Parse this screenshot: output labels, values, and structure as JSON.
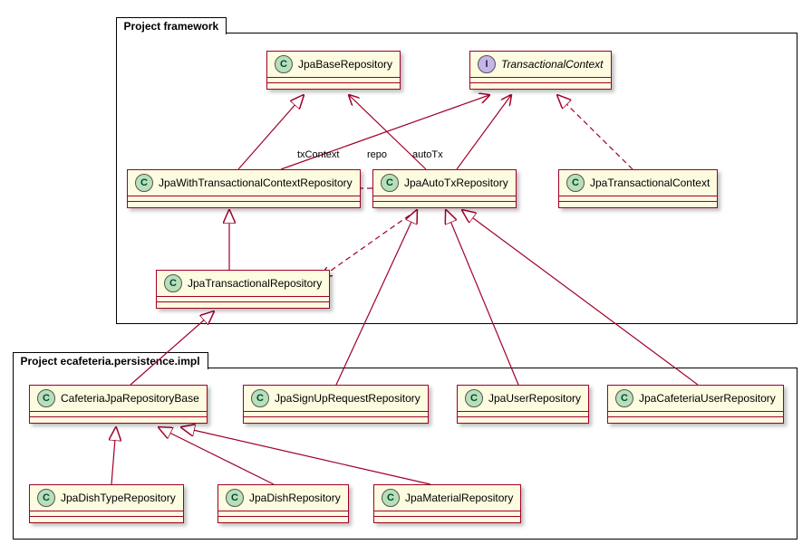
{
  "chart_data": {
    "type": "uml-class-diagram",
    "packages": [
      {
        "id": "pkg-framework",
        "name": "Project framework"
      },
      {
        "id": "pkg-impl",
        "name": "Project ecafeteria.persistence.impl"
      }
    ],
    "classes": [
      {
        "id": "JpaBaseRepository",
        "name": "JpaBaseRepository",
        "stereotype": "C",
        "package": "pkg-framework"
      },
      {
        "id": "TransactionalContext",
        "name": "TransactionalContext",
        "stereotype": "I",
        "italic": true,
        "package": "pkg-framework"
      },
      {
        "id": "JpaWithTransactionalContextRepository",
        "name": "JpaWithTransactionalContextRepository",
        "stereotype": "C",
        "package": "pkg-framework"
      },
      {
        "id": "JpaAutoTxRepository",
        "name": "JpaAutoTxRepository",
        "stereotype": "C",
        "package": "pkg-framework"
      },
      {
        "id": "JpaTransactionalContext",
        "name": "JpaTransactionalContext",
        "stereotype": "C",
        "package": "pkg-framework"
      },
      {
        "id": "JpaTransactionalRepository",
        "name": "JpaTransactionalRepository",
        "stereotype": "C",
        "package": "pkg-framework"
      },
      {
        "id": "CafeteriaJpaRepositoryBase",
        "name": "CafeteriaJpaRepositoryBase",
        "stereotype": "C",
        "package": "pkg-impl"
      },
      {
        "id": "JpaSignUpRequestRepository",
        "name": "JpaSignUpRequestRepository",
        "stereotype": "C",
        "package": "pkg-impl"
      },
      {
        "id": "JpaUserRepository",
        "name": "JpaUserRepository",
        "stereotype": "C",
        "package": "pkg-impl"
      },
      {
        "id": "JpaCafeteriaUserRepository",
        "name": "JpaCafeteriaUserRepository",
        "stereotype": "C",
        "package": "pkg-impl"
      },
      {
        "id": "JpaDishTypeRepository",
        "name": "JpaDishTypeRepository",
        "stereotype": "C",
        "package": "pkg-impl"
      },
      {
        "id": "JpaDishRepository",
        "name": "JpaDishRepository",
        "stereotype": "C",
        "package": "pkg-impl"
      },
      {
        "id": "JpaMaterialRepository",
        "name": "JpaMaterialRepository",
        "stereotype": "C",
        "package": "pkg-impl"
      }
    ],
    "relationships": [
      {
        "from": "JpaWithTransactionalContextRepository",
        "to": "JpaBaseRepository",
        "type": "generalization"
      },
      {
        "from": "JpaAutoTxRepository",
        "to": "TransactionalContext",
        "type": "association",
        "label": "autoTx"
      },
      {
        "from": "JpaWithTransactionalContextRepository",
        "to": "TransactionalContext",
        "type": "association",
        "label": "txContext"
      },
      {
        "from": "JpaAutoTxRepository",
        "to": "JpaBaseRepository",
        "type": "association",
        "label": "repo"
      },
      {
        "from": "JpaTransactionalContext",
        "to": "TransactionalContext",
        "type": "realization"
      },
      {
        "from": "JpaTransactionalRepository",
        "to": "JpaWithTransactionalContextRepository",
        "type": "generalization"
      },
      {
        "from": "JpaAutoTxRepository",
        "to": "JpaWithTransactionalContextRepository",
        "type": "dependency"
      },
      {
        "from": "JpaAutoTxRepository",
        "to": "JpaTransactionalRepository",
        "type": "dependency"
      },
      {
        "from": "CafeteriaJpaRepositoryBase",
        "to": "JpaTransactionalRepository",
        "type": "generalization"
      },
      {
        "from": "JpaSignUpRequestRepository",
        "to": "JpaAutoTxRepository",
        "type": "generalization"
      },
      {
        "from": "JpaUserRepository",
        "to": "JpaAutoTxRepository",
        "type": "generalization"
      },
      {
        "from": "JpaCafeteriaUserRepository",
        "to": "JpaAutoTxRepository",
        "type": "generalization"
      },
      {
        "from": "JpaDishTypeRepository",
        "to": "CafeteriaJpaRepositoryBase",
        "type": "generalization"
      },
      {
        "from": "JpaDishRepository",
        "to": "CafeteriaJpaRepositoryBase",
        "type": "generalization"
      },
      {
        "from": "JpaMaterialRepository",
        "to": "CafeteriaJpaRepositoryBase",
        "type": "generalization"
      }
    ],
    "edge_labels": [
      "txContext",
      "repo",
      "autoTx"
    ]
  },
  "packages": {
    "framework": "Project framework",
    "impl": "Project ecafeteria.persistence.impl"
  },
  "classes": {
    "JpaBaseRepository": "JpaBaseRepository",
    "TransactionalContext": "TransactionalContext",
    "JpaWithTransactionalContextRepository": "JpaWithTransactionalContextRepository",
    "JpaAutoTxRepository": "JpaAutoTxRepository",
    "JpaTransactionalContext": "JpaTransactionalContext",
    "JpaTransactionalRepository": "JpaTransactionalRepository",
    "CafeteriaJpaRepositoryBase": "CafeteriaJpaRepositoryBase",
    "JpaSignUpRequestRepository": "JpaSignUpRequestRepository",
    "JpaUserRepository": "JpaUserRepository",
    "JpaCafeteriaUserRepository": "JpaCafeteriaUserRepository",
    "JpaDishTypeRepository": "JpaDishTypeRepository",
    "JpaDishRepository": "JpaDishRepository",
    "JpaMaterialRepository": "JpaMaterialRepository"
  },
  "labels": {
    "txContext": "txContext",
    "repo": "repo",
    "autoTx": "autoTx"
  },
  "stereo": {
    "C": "C",
    "I": "I"
  }
}
